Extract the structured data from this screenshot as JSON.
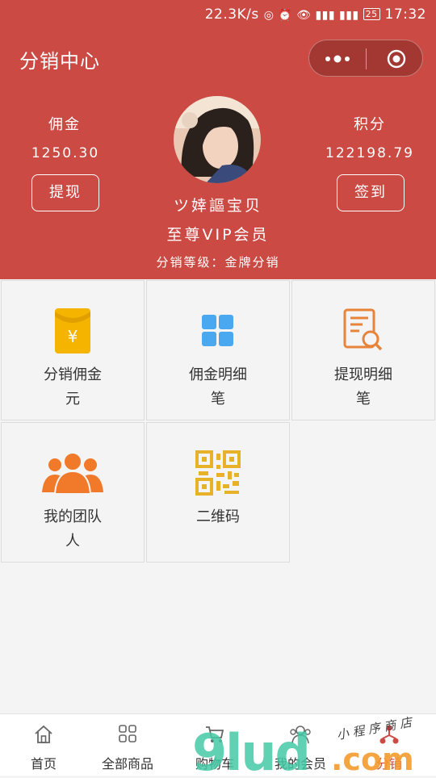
{
  "status_bar": {
    "speed": "22.3K/s",
    "battery": "25",
    "time": "17:32"
  },
  "header": {
    "title": "分销中心",
    "left_stat": {
      "label": "佣金",
      "value": "1250.30",
      "button": "提现"
    },
    "right_stat": {
      "label": "积分",
      "value": "122198.79",
      "button": "签到"
    },
    "nickname": "ツ婞謳宝贝",
    "vip_level": "至尊VIP会员",
    "distribution_level": "分销等级：金牌分销"
  },
  "grid": [
    {
      "label": "分销佣金",
      "sub": "元",
      "icon": "red-envelope-icon",
      "color": "#f5b400"
    },
    {
      "label": "佣金明细",
      "sub": "笔",
      "icon": "grid-icon",
      "color": "#4aa8f0"
    },
    {
      "label": "提现明细",
      "sub": "笔",
      "icon": "document-search-icon",
      "color": "#e8843a"
    },
    {
      "label": "我的团队",
      "sub": "人",
      "icon": "team-icon",
      "color": "#f07a2a"
    },
    {
      "label": "二维码",
      "sub": "",
      "icon": "qr-code-icon",
      "color": "#e8b12a"
    }
  ],
  "tabs": [
    {
      "label": "首页",
      "icon": "home-icon"
    },
    {
      "label": "全部商品",
      "icon": "apps-icon"
    },
    {
      "label": "购物车",
      "icon": "cart-icon"
    },
    {
      "label": "我的会员",
      "icon": "members-icon"
    },
    {
      "label": "分销",
      "icon": "distribution-icon"
    }
  ],
  "watermark": {
    "text": "9lud.com",
    "tagline": "小程序商店"
  },
  "colors": {
    "header": "#cb4a44",
    "accent_red": "#cb4a44",
    "watermark_green": "#44c9a4",
    "watermark_orange": "#f39a2c"
  }
}
